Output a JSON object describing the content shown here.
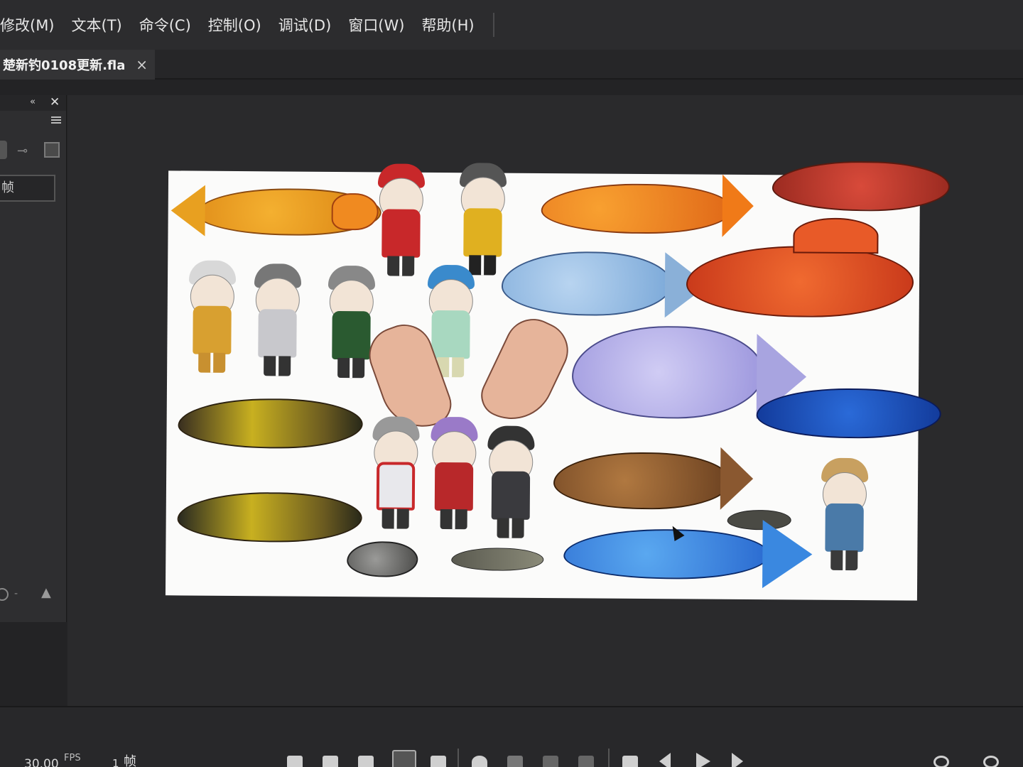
{
  "menu": {
    "items": [
      "修改(M)",
      "文本(T)",
      "命令(C)",
      "控制(O)",
      "调试(D)",
      "窗口(W)",
      "帮助(H)"
    ]
  },
  "document": {
    "tab_label": "楚新钓0108更新.fla",
    "close_glyph": "×"
  },
  "left_panel": {
    "collapse_glyph": "«",
    "close_glyph": "✕",
    "frame_field": "帧"
  },
  "timeline": {
    "fps_value": "30.00",
    "fps_label": "FPS",
    "frame_number": "1",
    "frame_label": "帧"
  },
  "colors": {
    "stage_bg": "#fbfbfa",
    "app_bg": "#232325",
    "gold_fish": "#e8a020",
    "red_fish": "#d8452a",
    "blue_fish": "#3a7fd0",
    "lavender_fish": "#b4b0e8"
  }
}
